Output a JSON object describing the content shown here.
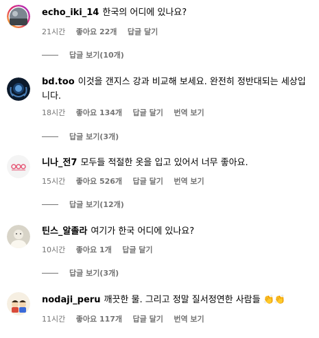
{
  "comments": [
    {
      "username": "echo_iki_14",
      "text": "한국의 어디에 있나요?",
      "time": "21시간",
      "likes": "좋아요 22개",
      "reply": "답글 달기",
      "translate": "",
      "view_replies": "답글 보기(10개)"
    },
    {
      "username": "bd.too",
      "text": "이것을 갠지스 강과 비교해 보세요. 완전히 정반대되는 세상입니다.",
      "time": "18시간",
      "likes": "좋아요 134개",
      "reply": "답글 달기",
      "translate": "번역 보기",
      "view_replies": "답글 보기(3개)"
    },
    {
      "username": "니나_전7",
      "text": "모두들 적절한 옷을 입고 있어서 너무 좋아요.",
      "time": "15시간",
      "likes": "좋아요 526개",
      "reply": "답글 달기",
      "translate": "번역 보기",
      "view_replies": "답글 보기(12개)"
    },
    {
      "username": "틴스_알졸라",
      "text": "여기가 한국 어디에 있나요?",
      "time": "10시간",
      "likes": "좋아요 1개",
      "reply": "답글 달기",
      "translate": "",
      "view_replies": "답글 보기(3개)"
    },
    {
      "username": "nodaji_peru",
      "text": "깨끗한 물. 그리고 정말 질서정연한 사람들 👏👏",
      "time": "11시간",
      "likes": "좋아요 117개",
      "reply": "답글 달기",
      "translate": "번역 보기",
      "view_replies": ""
    }
  ]
}
